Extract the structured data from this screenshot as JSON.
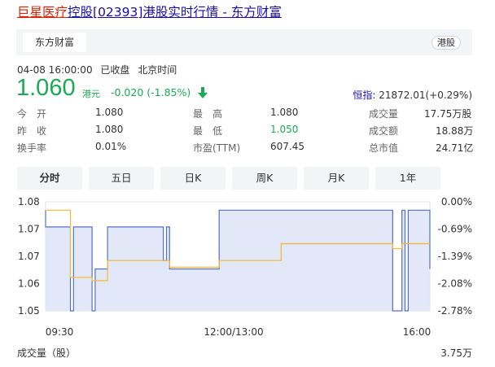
{
  "header": {
    "title_part1": "巨星医疗",
    "title_part2": "控股[02393]港股实时行情 - 东方财富"
  },
  "tabbar": {
    "active_tab": "东方财富",
    "market_badge": "港股"
  },
  "meta": {
    "datetime": "04-08 16:00:00",
    "status": "已收盘",
    "timezone": "北京时间"
  },
  "quote": {
    "price": "1.060",
    "unit": "港元",
    "change": "-0.020 (-1.85%)",
    "index_label": "恒指",
    "index_value": ": 21872.01(+0.29%)"
  },
  "stats": [
    [
      {
        "label": "今　开",
        "value": "1.080"
      },
      {
        "label": "最　高",
        "value": "1.080"
      },
      {
        "label": "成交量",
        "value": "17.75万股"
      }
    ],
    [
      {
        "label": "昨　收",
        "value": "1.080"
      },
      {
        "label": "最　低",
        "value": "1.050",
        "color": "green"
      },
      {
        "label": "成交额",
        "value": "18.88万"
      }
    ],
    [
      {
        "label": "换手率",
        "value": "0.01%"
      },
      {
        "label": "市盈(TTM)",
        "value": "607.45"
      },
      {
        "label": "总市值",
        "value": "24.71亿"
      }
    ]
  ],
  "periods": [
    "分时",
    "五日",
    "日K",
    "周K",
    "月K",
    "1年"
  ],
  "volume": {
    "label": "成交量（股）",
    "max": "3.75万"
  },
  "colors": {
    "down": "#1aaa55",
    "price_line": "#5470c6",
    "avg_line": "#f5b82e",
    "fill": "#dde4f7"
  },
  "chart_data": {
    "type": "line",
    "y_ticks_left": [
      "1.08",
      "1.07",
      "1.07",
      "1.06",
      "1.05"
    ],
    "y_ticks_right": [
      "0.00%",
      "-0.69%",
      "-1.39%",
      "-2.08%",
      "-2.78%"
    ],
    "x_ticks": [
      "09:30",
      "12:00/13:00",
      "16:00"
    ],
    "ylim": [
      1.0475,
      1.08
    ],
    "series": [
      {
        "points": [
          [
            0,
            1.0775
          ],
          [
            0,
            1.0725
          ],
          [
            8,
            1.0725
          ],
          [
            8,
            1.0475
          ],
          [
            9,
            1.0475
          ],
          [
            9,
            1.0725
          ],
          [
            15,
            1.0725
          ],
          [
            15,
            1.0475
          ],
          [
            16,
            1.0475
          ],
          [
            16,
            1.06
          ],
          [
            20,
            1.06
          ],
          [
            20,
            1.0725
          ],
          [
            38,
            1.0725
          ],
          [
            38,
            1.0625
          ],
          [
            39,
            1.0625
          ],
          [
            39,
            1.0725
          ],
          [
            40,
            1.0725
          ],
          [
            40,
            1.06
          ],
          [
            56,
            1.06
          ],
          [
            56,
            1.0775
          ],
          [
            112,
            1.0775
          ],
          [
            112,
            1.0475
          ],
          [
            115,
            1.0475
          ],
          [
            115,
            1.0775
          ],
          [
            116,
            1.0775
          ],
          [
            116,
            1.0475
          ],
          [
            117,
            1.0475
          ],
          [
            117,
            1.0775
          ],
          [
            124,
            1.0775
          ],
          [
            124,
            1.06
          ]
        ]
      },
      {
        "points": [
          [
            0,
            1.0775
          ],
          [
            8,
            1.0775
          ],
          [
            8,
            1.0575
          ],
          [
            15,
            1.0575
          ],
          [
            15,
            1.0565
          ],
          [
            20,
            1.0565
          ],
          [
            20,
            1.0625
          ],
          [
            40,
            1.0625
          ],
          [
            40,
            1.0605
          ],
          [
            56,
            1.0605
          ],
          [
            56,
            1.0625
          ],
          [
            76,
            1.0625
          ],
          [
            76,
            1.0675
          ],
          [
            112,
            1.0675
          ],
          [
            112,
            1.066
          ],
          [
            115,
            1.066
          ],
          [
            115,
            1.0675
          ],
          [
            124,
            1.0675
          ]
        ]
      }
    ]
  }
}
